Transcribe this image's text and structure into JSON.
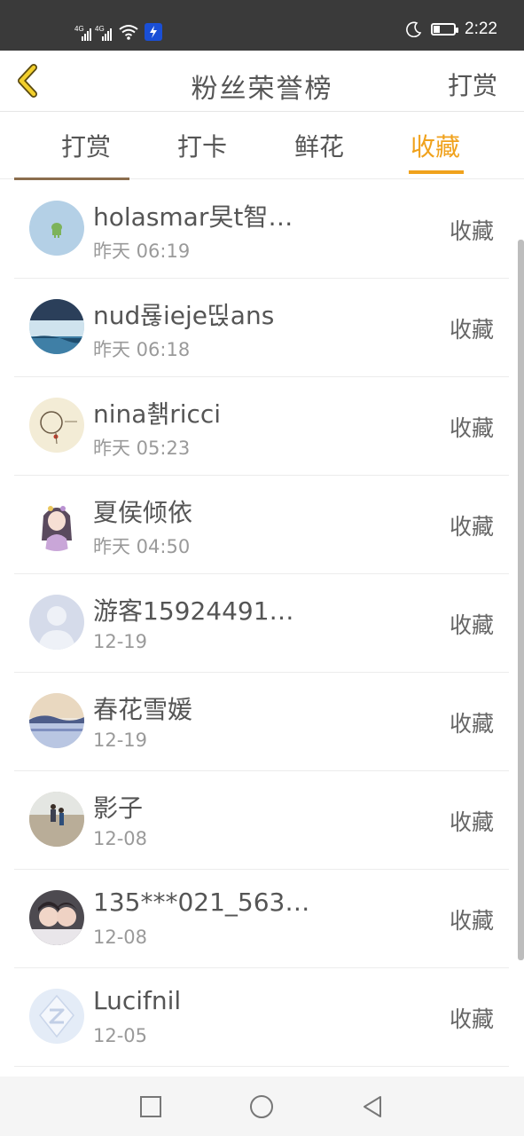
{
  "status_bar": {
    "network_1": "4G",
    "network_2": "4G",
    "time": "2:22"
  },
  "header": {
    "title": "粉丝荣誉榜",
    "right_action": "打赏"
  },
  "tabs": [
    {
      "label": "打赏",
      "active": false
    },
    {
      "label": "打卡",
      "active": false
    },
    {
      "label": "鲜花",
      "active": false
    },
    {
      "label": "收藏",
      "active": true
    }
  ],
  "accent_color": "#f0a21d",
  "list": [
    {
      "name": "holasmar旲t智…",
      "time": "昨天 06:19",
      "action": "收藏",
      "avatar": "green-android-avatar"
    },
    {
      "name": "nud룒ieje띥ans",
      "time": "昨天 06:18",
      "action": "收藏",
      "avatar": "sea-sky-avatar"
    },
    {
      "name": "nina쵉ricci",
      "time": "昨天 05:23",
      "action": "收藏",
      "avatar": "bracelet-avatar"
    },
    {
      "name": "夏侯倾依",
      "time": "昨天 04:50",
      "action": "收藏",
      "avatar": "anime-girl-avatar"
    },
    {
      "name": "游客15924491…",
      "time": "12-19",
      "action": "收藏",
      "avatar": "default-user-avatar"
    },
    {
      "name": "春花雪媛",
      "time": "12-19",
      "action": "收藏",
      "avatar": "lake-scenery-avatar"
    },
    {
      "name": "影子",
      "time": "12-08",
      "action": "收藏",
      "avatar": "beach-person-avatar"
    },
    {
      "name": "135***021_563…",
      "time": "12-08",
      "action": "收藏",
      "avatar": "couple-photo-avatar"
    },
    {
      "name": "Lucifnil",
      "time": "12-05",
      "action": "收藏",
      "avatar": "qq-logo-avatar"
    }
  ]
}
